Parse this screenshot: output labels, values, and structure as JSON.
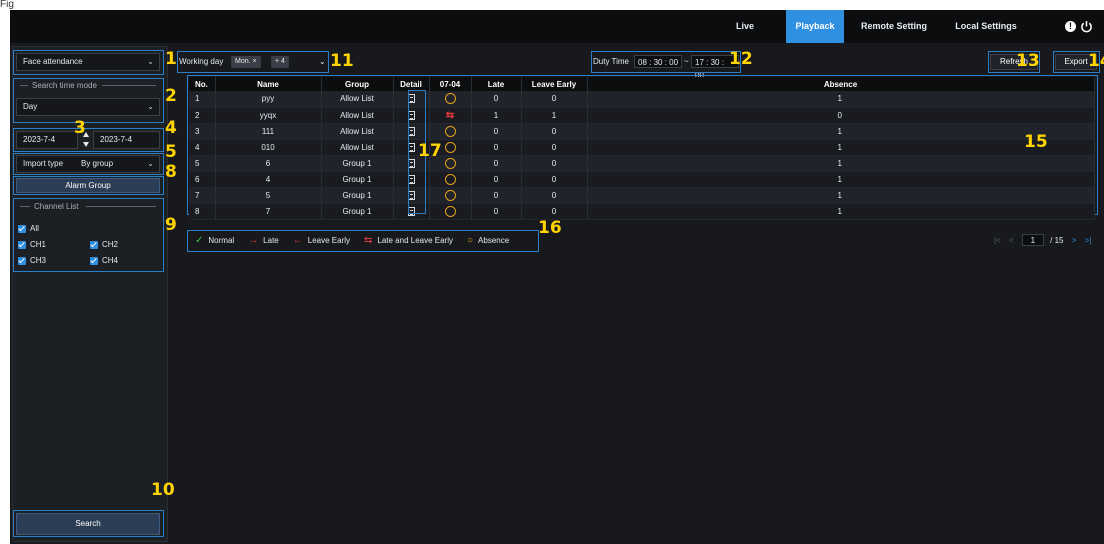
{
  "figure_label": "Fig",
  "nav": {
    "items": [
      "Live",
      "Playback",
      "Remote Setting",
      "Local Settings"
    ],
    "active": "Playback",
    "accent": "#2f8fe0"
  },
  "icons": {
    "alert": "!",
    "power": "power-icon"
  },
  "left": {
    "mode_select": "Face attendance",
    "search_time_mode_title": "Search time mode",
    "search_time_mode_value": "Day",
    "date_start": "2023-7-4",
    "date_end": "2023-7-4",
    "import_type_label": "Import type",
    "import_type_value": "By group",
    "alarm_group_button": "Alarm Group",
    "channel_list_title": "Channel List",
    "channels": [
      "All",
      "CH1",
      "CH2",
      "CH3",
      "CH4"
    ],
    "search_button": "Search"
  },
  "toolbar": {
    "working_day_label": "Working day",
    "working_day_tag": "Mon. ×",
    "working_day_more": "+ 4",
    "duty_time_label": "Duty Time",
    "duty_start": "08 : 30 : 00",
    "duty_sep": "~",
    "duty_end": "17 : 30 : 00",
    "refresh_button": "Refresh",
    "export_button": "Export"
  },
  "table": {
    "headers": [
      "No.",
      "Name",
      "Group",
      "Detail",
      "07-04",
      "Late",
      "Leave Early",
      "Absence"
    ],
    "rows": [
      {
        "no": "1",
        "name": "pyy",
        "group": "Allow List",
        "status": "absence",
        "late": "0",
        "leave_early": "0",
        "absence": "1"
      },
      {
        "no": "2",
        "name": "yyqx",
        "group": "Allow List",
        "status": "late-and-leave-early",
        "late": "1",
        "leave_early": "1",
        "absence": "0"
      },
      {
        "no": "3",
        "name": "111",
        "group": "Allow List",
        "status": "absence",
        "late": "0",
        "leave_early": "0",
        "absence": "1"
      },
      {
        "no": "4",
        "name": "010",
        "group": "Allow List",
        "status": "absence",
        "late": "0",
        "leave_early": "0",
        "absence": "1"
      },
      {
        "no": "5",
        "name": "6",
        "group": "Group 1",
        "status": "absence",
        "late": "0",
        "leave_early": "0",
        "absence": "1"
      },
      {
        "no": "6",
        "name": "4",
        "group": "Group 1",
        "status": "absence",
        "late": "0",
        "leave_early": "0",
        "absence": "1"
      },
      {
        "no": "7",
        "name": "5",
        "group": "Group 1",
        "status": "absence",
        "late": "0",
        "leave_early": "0",
        "absence": "1"
      },
      {
        "no": "8",
        "name": "7",
        "group": "Group 1",
        "status": "absence",
        "late": "0",
        "leave_early": "0",
        "absence": "1"
      }
    ]
  },
  "legend": [
    {
      "label": "Normal",
      "symbol": "✓",
      "color": "#3cc24a"
    },
    {
      "label": "Late",
      "symbol": "→",
      "color": "#e23a3a"
    },
    {
      "label": "Leave Early",
      "symbol": "←",
      "color": "#e23a3a"
    },
    {
      "label": "Late and Leave Early",
      "symbol": "⇆",
      "color": "#e23a3a"
    },
    {
      "label": "Absence",
      "symbol": "○",
      "color": "#e3a21a"
    }
  ],
  "pager": {
    "first": "|<",
    "prev": "<",
    "page": "1",
    "total": "/ 15",
    "next": ">",
    "last": ">|"
  },
  "callouts": [
    "1",
    "2",
    "3",
    "4",
    "5",
    "8",
    "9",
    "10",
    "11",
    "12",
    "13",
    "14",
    "15",
    "16",
    "17"
  ]
}
